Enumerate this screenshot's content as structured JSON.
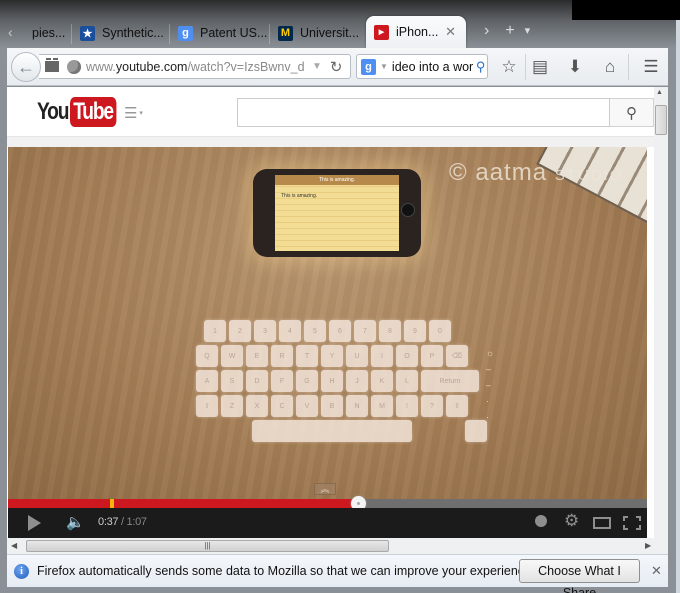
{
  "browser": {
    "tabs": [
      {
        "label": "pies...",
        "favicon": "generic-favicon",
        "active": false
      },
      {
        "label": "Synthetic...",
        "favicon": "star-favicon",
        "active": false
      },
      {
        "label": "Patent US...",
        "favicon": "google-favicon",
        "active": false
      },
      {
        "label": "Universit...",
        "favicon": "michigan-m-favicon",
        "active": false
      },
      {
        "label": "iPhon...",
        "favicon": "youtube-favicon",
        "active": true
      }
    ],
    "tab_controls": {
      "scroll_right": "›",
      "new_tab": "+",
      "list_all": "▾",
      "scroll_left": "‹"
    },
    "url": {
      "host_prefix": "www.",
      "host": "youtube.com",
      "path": "/watch?v=IzsBwnv_d"
    },
    "search": {
      "value": "ideo into a wor",
      "engine": "Google"
    },
    "icons": {
      "back": "←",
      "reload": "↻",
      "bookmark_star": "☆",
      "reading_list": "▤",
      "downloads": "⬇",
      "home": "⌂",
      "menu": "☰",
      "search_go": "⚲",
      "close": "✕"
    },
    "colors": {
      "youtube_red": "#cc181e",
      "progress_marker": "#f9b40b",
      "player_bg": "#1b1b1b"
    }
  },
  "youtube": {
    "logo_you": "You",
    "logo_tube": "Tube",
    "guide_icon": "☰",
    "search_placeholder": "",
    "search_icon": "⚲"
  },
  "video": {
    "watermark": "© aatma",
    "watermark_small": "STUDIO",
    "phone_title": "This is amazing.",
    "phone_note": "This is amazing.",
    "keyboard_rows": [
      [
        "1",
        "2",
        "3",
        "4",
        "5",
        "6",
        "7",
        "8",
        "9",
        "0"
      ],
      [
        "Q",
        "W",
        "E",
        "R",
        "T",
        "Y",
        "U",
        "I",
        "O",
        "P",
        "⌫"
      ],
      [
        "A",
        "S",
        "D",
        "F",
        "G",
        "H",
        "J",
        "K",
        "L",
        "Return"
      ],
      [
        "⇧",
        "Z",
        "X",
        "C",
        "V",
        "B",
        "N",
        "M",
        "!",
        "?",
        "⇧"
      ]
    ],
    "up_chevron": "︽"
  },
  "player": {
    "current_time": "0:37",
    "separator": " / ",
    "duration": "1:07",
    "played_fraction": 0.547,
    "marker_fraction": 0.159,
    "volume_icon": "🔈",
    "settings_icon": "⚙"
  },
  "scrollbars": {
    "hthumb_grip": "|||",
    "up": "▲",
    "down": "▼",
    "left": "◀",
    "right": "▶"
  },
  "notification": {
    "text": "Firefox automatically sends some data to Mozilla so that we can improve your experience.",
    "button": "Choose What I Share",
    "info_icon": "i",
    "close": "✕"
  }
}
